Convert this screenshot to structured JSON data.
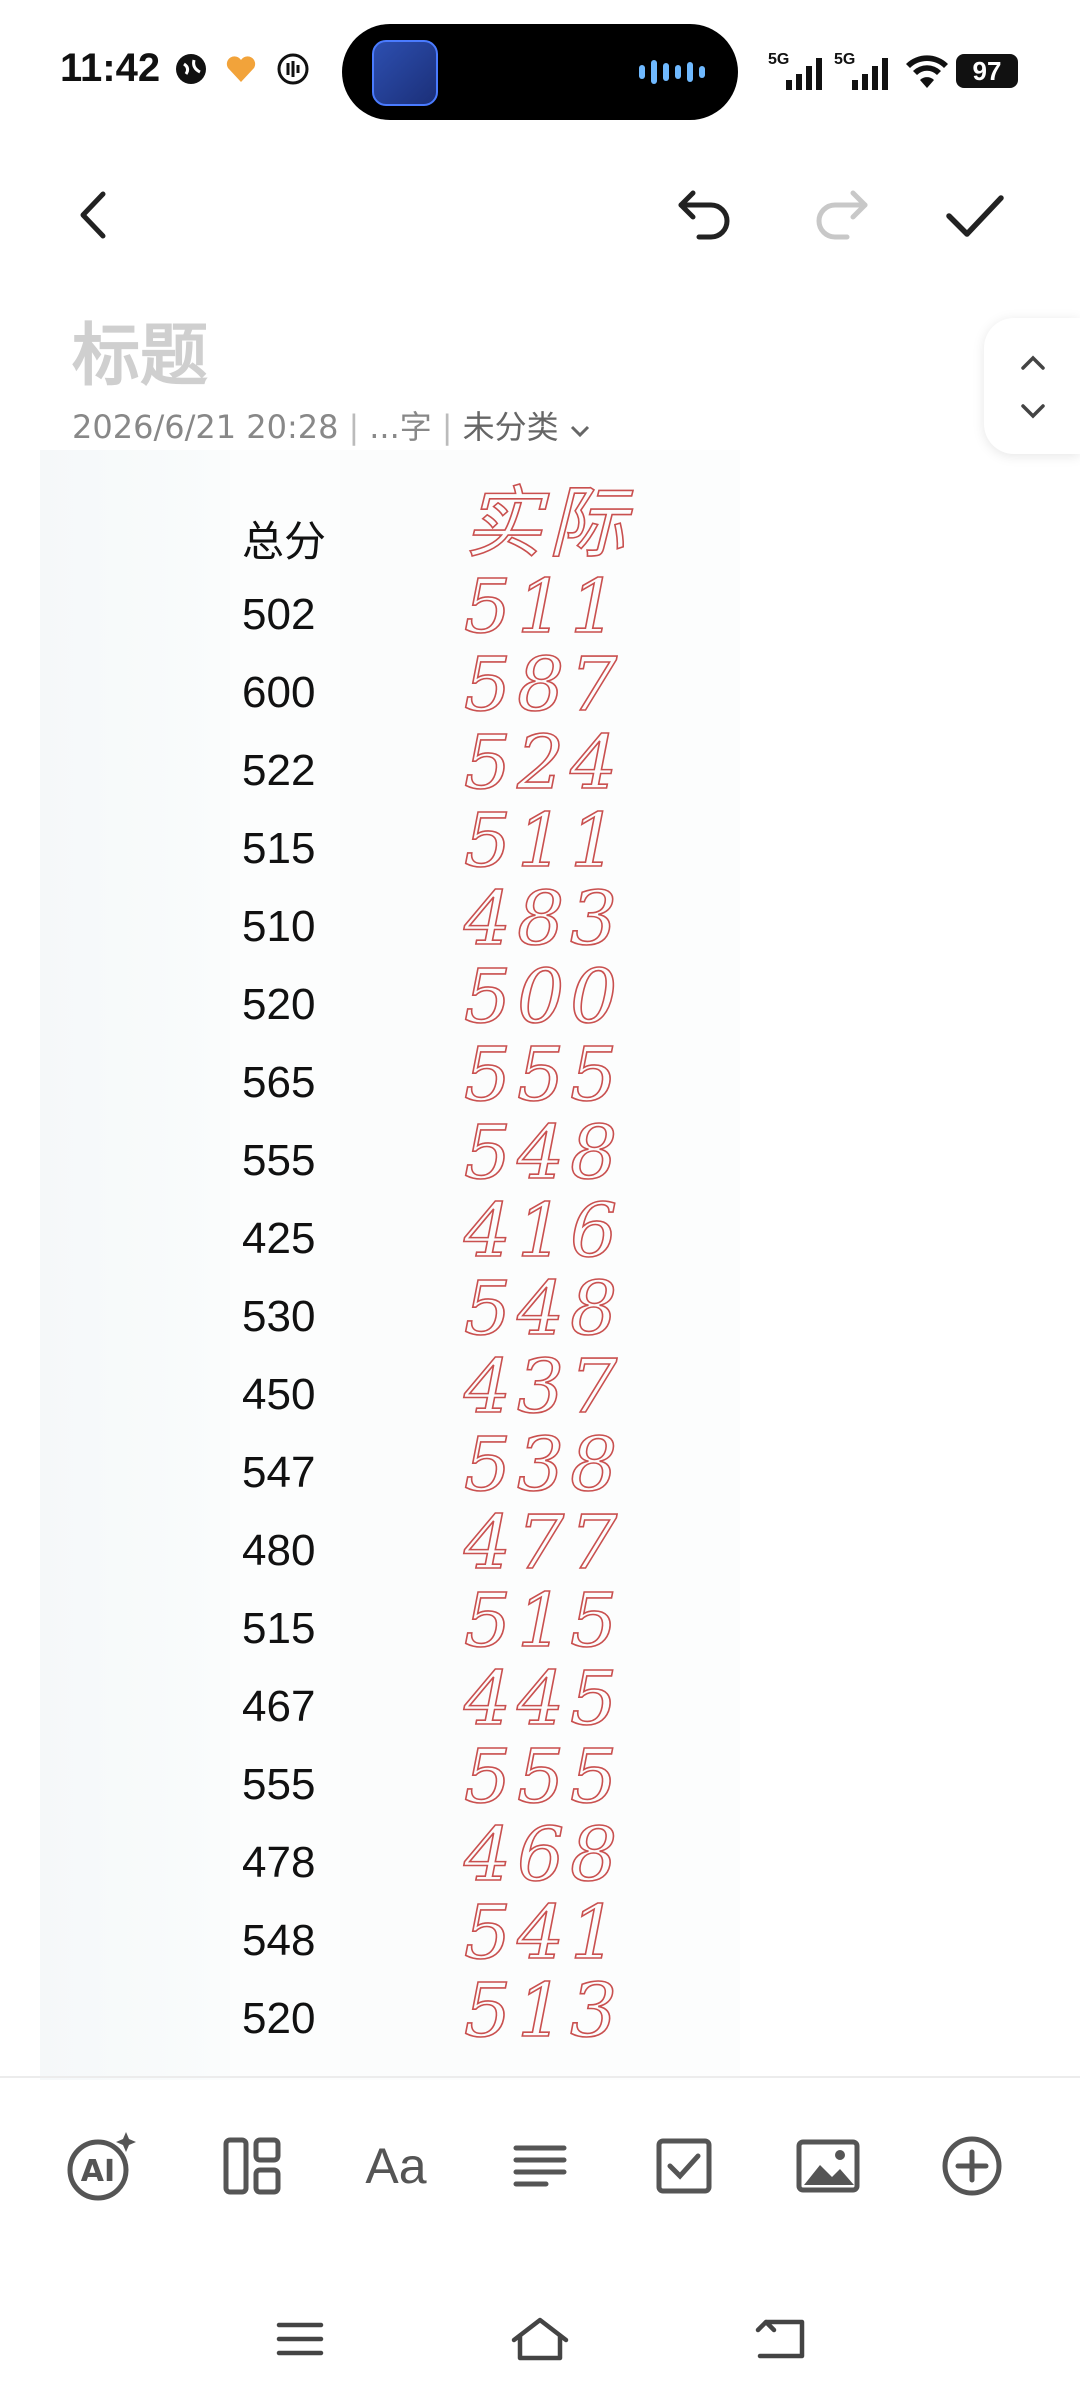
{
  "status_bar": {
    "time": "11:42",
    "signal1_label": "5G",
    "signal2_label": "5G",
    "battery": "97"
  },
  "toolbar": {
    "back_icon": "back-arrow-icon",
    "undo_icon": "undo-icon",
    "redo_icon": "redo-icon",
    "done_icon": "check-icon"
  },
  "note": {
    "title_placeholder": "标题",
    "date": "2026/6/21 20:28",
    "word_count": "...字",
    "category": "未分类"
  },
  "note_image": {
    "header": "总分",
    "scores": [
      "502",
      "600",
      "522",
      "515",
      "510",
      "520",
      "565",
      "555",
      "425",
      "530",
      "450",
      "547",
      "480",
      "515",
      "467",
      "555",
      "478",
      "548",
      "520"
    ],
    "handwritten_header": "实际",
    "handwritten_values": [
      "511",
      "587",
      "524",
      "511",
      "483",
      "500",
      "555",
      "548",
      "416",
      "548",
      "437",
      "538",
      "477",
      "515",
      "445",
      "555",
      "468",
      "541",
      "513"
    ],
    "ink_color": "#c9504f"
  },
  "bottom_tools": {
    "ai_label": "AI",
    "font_label": "Aa"
  }
}
